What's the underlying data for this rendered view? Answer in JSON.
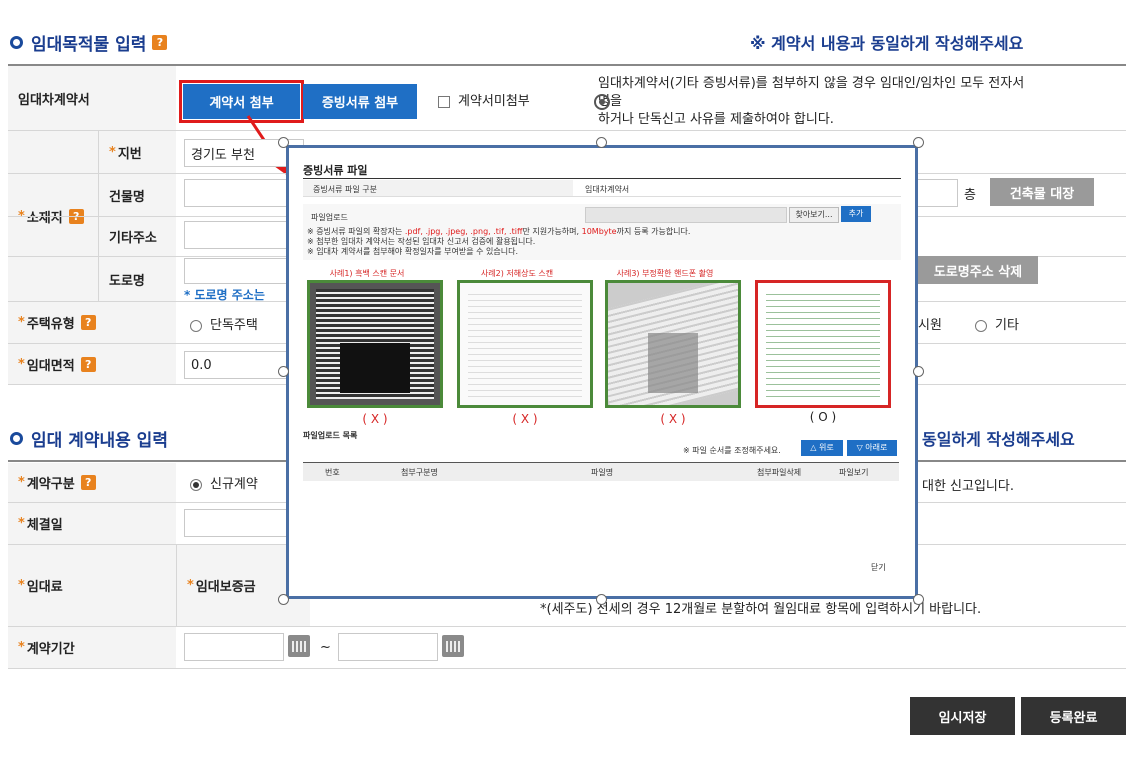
{
  "section1": {
    "title": "임대목적물 입력",
    "help": "?",
    "notice": "※ 계약서 내용과 동일하게 작성해주세요"
  },
  "contract_row": {
    "label": "임대차계약서",
    "attach_contract": "계약서 첨부",
    "attach_evidence": "증빙서류 첨부",
    "no_contract_checkbox": "계약서미첨부",
    "note_line1": "임대차계약서(기타 증빙서류)를 첨부하지 않을 경우 임대인/임차인 모두 전자서",
    "note_line2": "명을",
    "note_line3": "하거나 단독신고 사유를 제출하여야 합니다."
  },
  "location": {
    "label": "소재지",
    "help": "?",
    "jibun_label": "지번",
    "jibun_value": "경기도 부천",
    "building_label": "건물명",
    "floor_suffix": "층",
    "building_registry_btn": "건축물 대장",
    "other_addr_label": "기타주소",
    "road_label": "도로명",
    "road_delete_btn": "도로명주소 삭제",
    "road_note": "* 도로명 주소는"
  },
  "house_type": {
    "label": "주택유형",
    "help": "?",
    "option_single": "단독주택",
    "option_officetel": "시원",
    "option_other": "기타"
  },
  "rent_area": {
    "label": "임대면적",
    "help": "?",
    "value": "0.0"
  },
  "section2": {
    "title": "임대 계약내용 입력",
    "notice_partial": "동일하게 작성해주세요"
  },
  "contract_type": {
    "label": "계약구분",
    "help": "?",
    "option_new": "신규계약",
    "desc_partial": "대한 신고입니다."
  },
  "contract_date": {
    "label": "체결일"
  },
  "rent": {
    "label": "임대료",
    "deposit_label": "임대보증금",
    "note": "*(세주도) 전세의 경우 12개월로 분할하여 월임대료 항목에 입력하시기 바랍니다."
  },
  "period": {
    "label": "계약기간",
    "separator": "~"
  },
  "actions": {
    "temp_save": "임시저장",
    "complete": "등록완료"
  },
  "modal": {
    "title": "증빙서류 파일",
    "type_label": "증빙서류 파일 구분",
    "type_value": "임대차계약서",
    "upload_label": "파일업로드",
    "browse_btn": "찾아보기...",
    "add_btn": "추가",
    "note1_a": "※ 증빙서류 파일의 확장자는 ",
    "note1_ext": ".pdf, .jpg, .jpeg, .png, .tif, .tiff",
    "note1_b": "만 지원가능하며, ",
    "note1_size": "10Mbyte",
    "note1_c": "까지 등록 가능합니다.",
    "note2": "※ 첨부한 임대차 계약서는 작성된 임대차 신고서 검증에 활용됩니다.",
    "note3": "※ 임대차 계약서를 첨부해야 확정일자를 부여받을 수 있습니다.",
    "examples": [
      {
        "caption": "사례1) 흑백 스캔 문서",
        "mark": "( X )"
      },
      {
        "caption": "사례2) 저해상도 스캔",
        "mark": "( X )"
      },
      {
        "caption": "사례3) 부정확한 핸드폰 촬영",
        "mark": "( X )"
      },
      {
        "caption": "",
        "mark": "( O )"
      }
    ],
    "list_title": "파일업로드 목록",
    "order_note": "※ 파일 순서를 조정해주세요.",
    "up_btn": "△ 위로",
    "down_btn": "▽ 아래로",
    "columns": [
      "번호",
      "첨부구분명",
      "파일명",
      "첨부파일삭제",
      "파일보기"
    ],
    "close": "닫기"
  },
  "colors": {
    "accent_blue": "#1f6fc5",
    "title_blue": "#1a3d8f",
    "help_orange": "#e8821e",
    "highlight_red": "#e01b1b"
  }
}
